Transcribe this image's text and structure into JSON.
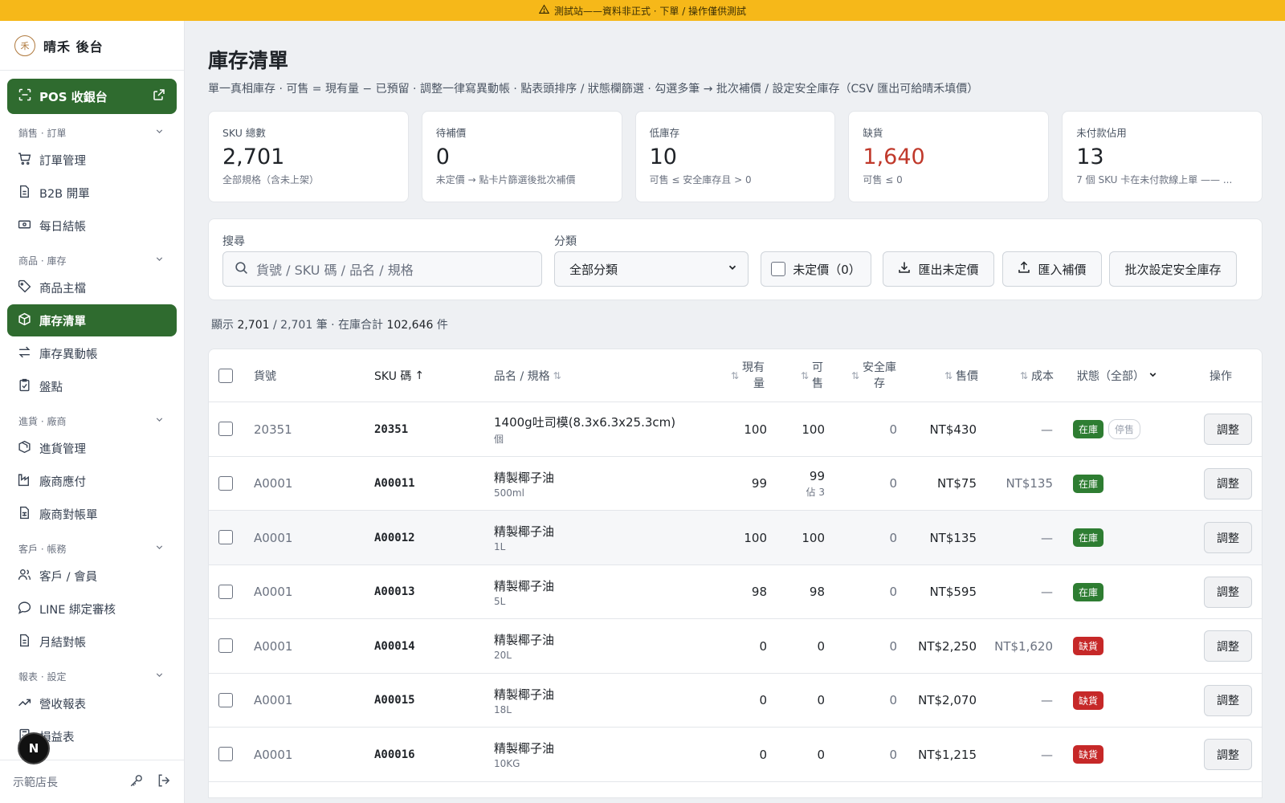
{
  "banner": {
    "text": "測試站——資料非正式 · 下單 / 操作僅供測試"
  },
  "brand": {
    "logo": "禾",
    "name": "晴禾 後台"
  },
  "pos": {
    "label": "POS 收銀台"
  },
  "nav": {
    "sec1": "銷售 · 訂單",
    "orders": "訂單管理",
    "b2b": "B2B 開單",
    "daily": "每日結帳",
    "sec2": "商品 · 庫存",
    "products": "商品主檔",
    "inventory": "庫存清單",
    "ledger": "庫存異動帳",
    "stocktake": "盤點",
    "sec3": "進貨 · 廠商",
    "purchase": "進貨管理",
    "payable": "廠商應付",
    "statement": "廠商對帳單",
    "sec4": "客戶 · 帳務",
    "customers": "客戶 / 會員",
    "line": "LINE 綁定審核",
    "monthly": "月結對帳",
    "sec5": "報表 · 設定",
    "revenue": "營收報表",
    "pnl": "損益表"
  },
  "footer": {
    "user": "示範店長",
    "avatar": "N"
  },
  "page": {
    "title": "庫存清單",
    "desc": "單一真相庫存 · 可售 = 現有量 − 已預留 · 調整一律寫異動帳 · 點表頭排序 / 狀態欄篩選 · 勾選多筆 → 批次補價 / 設定安全庫存（CSV 匯出可給晴禾填價）"
  },
  "kpis": [
    {
      "label": "SKU 總數",
      "value": "2,701",
      "sub": "全部規格（含未上架）"
    },
    {
      "label": "待補價",
      "value": "0",
      "sub": "未定價 → 點卡片篩選後批次補價"
    },
    {
      "label": "低庫存",
      "value": "10",
      "sub": "可售 ≤ 安全庫存且 > 0"
    },
    {
      "label": "缺貨",
      "value": "1,640",
      "sub": "可售 ≤ 0"
    },
    {
      "label": "未付款佔用",
      "value": "13",
      "sub": "7 個 SKU 卡在未付款線上單 —— ..."
    }
  ],
  "filters": {
    "search_label": "搜尋",
    "search_placeholder": "貨號 / SKU 碼 / 品名 / 規格",
    "category_label": "分類",
    "category_value": "全部分類",
    "unpriced": "未定價（0）",
    "export": "匯出未定價",
    "import": "匯入補價",
    "batch_safety": "批次設定安全庫存"
  },
  "summary": {
    "prefix": "顯示 ",
    "shown": "2,701",
    "sep": " / 2,701 筆 · 在庫合計 ",
    "total": "102,646",
    "suffix": " 件"
  },
  "table": {
    "headers": {
      "code": "貨號",
      "sku": "SKU 碼",
      "name": "品名 / 規格",
      "onhand1": "現有",
      "onhand2": "量",
      "avail1": "可",
      "avail2": "售",
      "safety1": "安全庫",
      "safety2": "存",
      "price": "售價",
      "cost": "成本",
      "status": "狀態（全部）",
      "action": "操作"
    },
    "rows": [
      {
        "code": "20351",
        "sku": "20351",
        "name": "1400g吐司模(8.3x6.3x25.3cm)",
        "spec": "個",
        "onhand": "100",
        "avail": "100",
        "reserved": "",
        "safety": "0",
        "price": "NT$430",
        "cost": "—",
        "status": "在庫",
        "status2": "停售",
        "action": "調整"
      },
      {
        "code": "A0001",
        "sku": "A00011",
        "name": "精製椰子油",
        "spec": "500ml",
        "onhand": "99",
        "avail": "99",
        "reserved": "佔 3",
        "safety": "0",
        "price": "NT$75",
        "cost": "NT$135",
        "status": "在庫",
        "status2": "",
        "action": "調整"
      },
      {
        "code": "A0001",
        "sku": "A00012",
        "name": "精製椰子油",
        "spec": "1L",
        "onhand": "100",
        "avail": "100",
        "reserved": "",
        "safety": "0",
        "price": "NT$135",
        "cost": "—",
        "status": "在庫",
        "status2": "",
        "action": "調整"
      },
      {
        "code": "A0001",
        "sku": "A00013",
        "name": "精製椰子油",
        "spec": "5L",
        "onhand": "98",
        "avail": "98",
        "reserved": "",
        "safety": "0",
        "price": "NT$595",
        "cost": "—",
        "status": "在庫",
        "status2": "",
        "action": "調整"
      },
      {
        "code": "A0001",
        "sku": "A00014",
        "name": "精製椰子油",
        "spec": "20L",
        "onhand": "0",
        "avail": "0",
        "reserved": "",
        "safety": "0",
        "price": "NT$2,250",
        "cost": "NT$1,620",
        "status": "缺貨",
        "status2": "",
        "action": "調整"
      },
      {
        "code": "A0001",
        "sku": "A00015",
        "name": "精製椰子油",
        "spec": "18L",
        "onhand": "0",
        "avail": "0",
        "reserved": "",
        "safety": "0",
        "price": "NT$2,070",
        "cost": "—",
        "status": "缺貨",
        "status2": "",
        "action": "調整"
      },
      {
        "code": "A0001",
        "sku": "A00016",
        "name": "精製椰子油",
        "spec": "10KG",
        "onhand": "0",
        "avail": "0",
        "reserved": "",
        "safety": "0",
        "price": "NT$1,215",
        "cost": "—",
        "status": "缺貨",
        "status2": "",
        "action": "調整"
      }
    ]
  },
  "colors": {
    "primary": "#2f6b2f",
    "banner": "#f6b819",
    "danger": "#c62828",
    "ok": "#2e7d32"
  }
}
